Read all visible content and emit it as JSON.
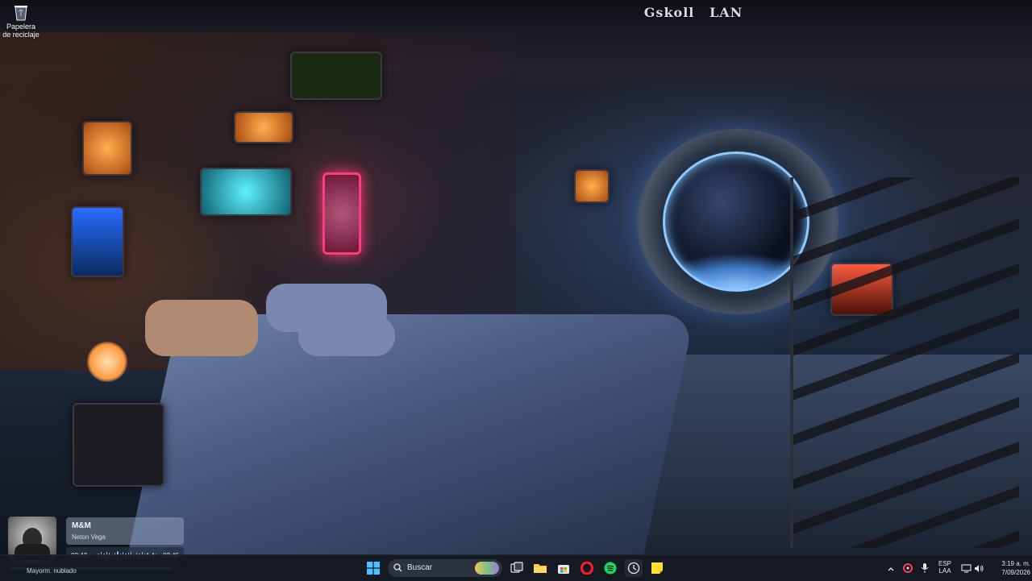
{
  "desktop": {
    "title_left": "Gskoll",
    "title_right": "LAN",
    "icons": [
      {
        "label": "Papelera de reciclaje",
        "icon": "recycle-bin-icon"
      }
    ]
  },
  "music_widget": {
    "track_title": "M&M",
    "artist": "Neton Vega",
    "current_time": "02:43",
    "total_time": "02:46",
    "progress": 0.98
  },
  "taskbar": {
    "weather_text": "Mayorm. nublado",
    "search_placeholder": "Buscar",
    "pinned_apps": [
      {
        "name": "start",
        "icon": "windows-start-icon"
      },
      {
        "name": "task-view",
        "icon": "task-view-icon"
      },
      {
        "name": "file-explorer",
        "icon": "folder-icon"
      },
      {
        "name": "microsoft-store",
        "icon": "store-icon"
      },
      {
        "name": "opera",
        "icon": "opera-icon"
      },
      {
        "name": "spotify",
        "icon": "spotify-icon"
      },
      {
        "name": "app-circle",
        "icon": "circular-app-icon"
      },
      {
        "name": "sticky-notes",
        "icon": "sticky-notes-icon"
      }
    ],
    "tray": {
      "language_top": "ESP",
      "language_bottom": "LAA",
      "time": "3:19 a. m.",
      "date": "7/09/2026"
    }
  },
  "colors": {
    "accent": "#5aa8ff",
    "taskbar_bg": "#161a22",
    "neon_pink": "#ff3c7a"
  }
}
